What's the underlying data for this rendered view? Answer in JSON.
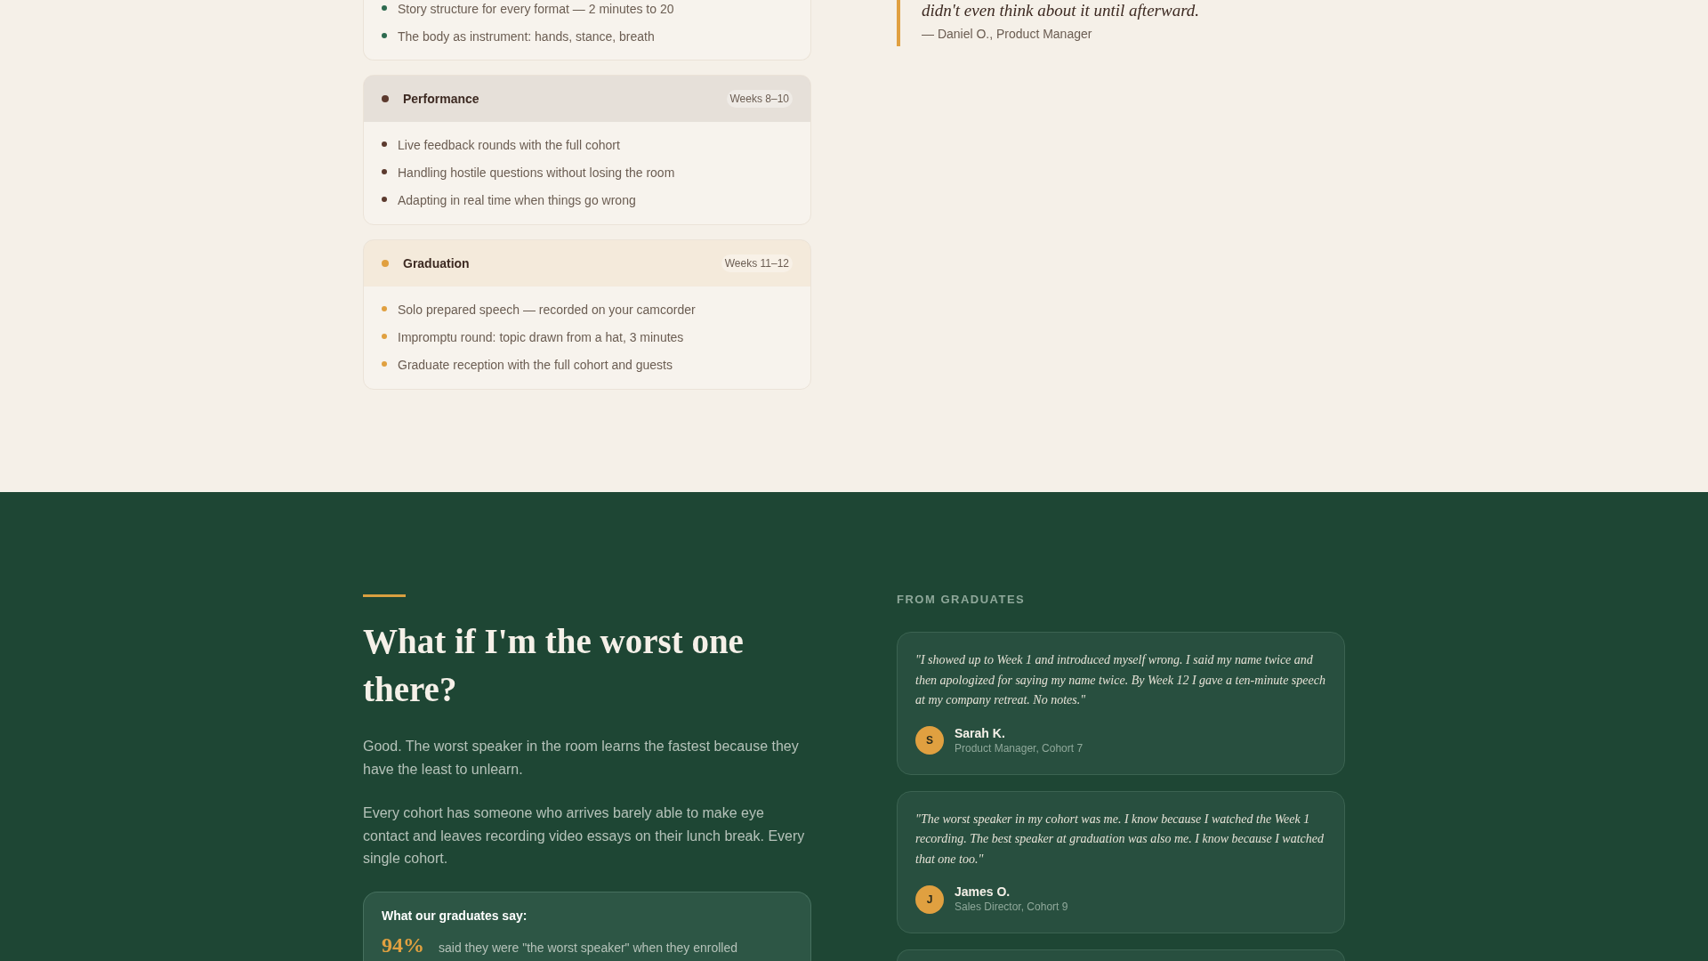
{
  "curriculum": {
    "phases": [
      {
        "color": "#2d6a4f",
        "items": [
          "Story structure for every format — 2 minutes to 20",
          "The body as instrument: hands, stance, breath"
        ]
      },
      {
        "title": "Performance",
        "weeks": "Weeks 8–10",
        "color": "#5c3a2e",
        "items": [
          "Live feedback rounds with the full cohort",
          "Handling hostile questions without losing the room",
          "Adapting in real time when things go wrong"
        ]
      },
      {
        "title": "Graduation",
        "weeks": "Weeks 11–12",
        "color": "#e0a040",
        "items": [
          "Solo prepared speech — recorded on your camcorder",
          "Impromptu round: topic drawn from a hat, 3 minutes",
          "Graduate reception with the full cohort and guests"
        ]
      }
    ]
  },
  "featured_quote": {
    "text": "didn't even think about it until afterward.",
    "attribution": "— Daniel O., Product Manager"
  },
  "faq": {
    "heading": "What if I'm the worst one there?",
    "paragraphs": [
      "Good. The worst speaker in the room learns the fastest because they have the least to unlearn.",
      "Every cohort has someone who arrives barely able to make eye contact and leaves recording video essays on their lunch break. Every single cohort."
    ],
    "stats": {
      "title": "What our graduates say:",
      "items": [
        {
          "value": "94%",
          "label": "said they were \"the worst speaker\" when they enrolled"
        }
      ]
    }
  },
  "testimonials": {
    "label": "FROM GRADUATES",
    "items": [
      {
        "quote": "\"I showed up to Week 1 and introduced myself wrong. I said my name twice and then apologized for saying my name twice. By Week 12 I gave a ten-minute speech at my company retreat. No notes.\"",
        "initial": "S",
        "name": "Sarah K.",
        "role": "Product Manager, Cohort 7"
      },
      {
        "quote": "\"The worst speaker in my cohort was me. I know because I watched the Week 1 recording. The best speaker at graduation was also me. I know because I watched that one too.\"",
        "initial": "J",
        "name": "James O.",
        "role": "Sales Director, Cohort 9"
      }
    ]
  }
}
